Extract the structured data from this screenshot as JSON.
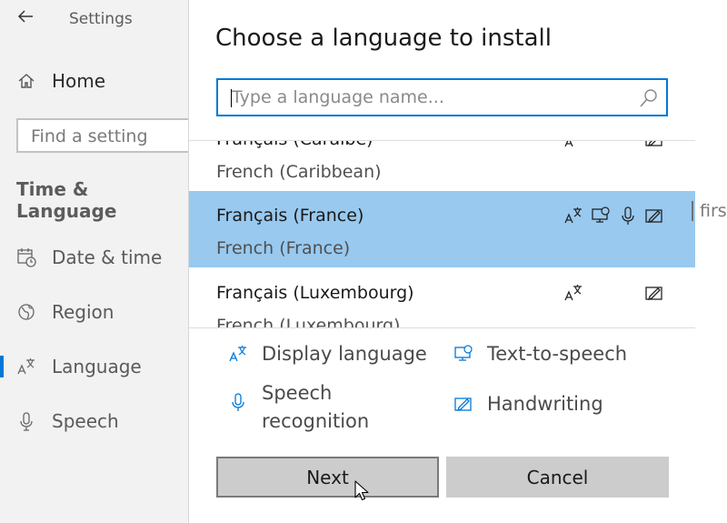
{
  "settings": {
    "title": "Settings",
    "home_label": "Home",
    "find_placeholder": "Find a setting",
    "section_header": "Time & Language",
    "nav": [
      {
        "label": "Date & time",
        "icon": "calendar-clock-icon"
      },
      {
        "label": "Region",
        "icon": "globe-icon"
      },
      {
        "label": "Language",
        "icon": "language-icon",
        "active": true
      },
      {
        "label": "Speech",
        "icon": "microphone-icon"
      }
    ]
  },
  "dialog": {
    "title": "Choose a language to install",
    "search_placeholder": "Type a language name...",
    "search_value": "",
    "languages": [
      {
        "native": "Français (Caraïbe)",
        "english": "French (Caribbean)",
        "features": [
          "display-language",
          "handwriting"
        ],
        "selected": false
      },
      {
        "native": "Français (France)",
        "english": "French (France)",
        "features": [
          "display-language",
          "text-to-speech",
          "speech-recognition",
          "handwriting"
        ],
        "selected": true
      },
      {
        "native": "Français (Luxembourg)",
        "english": "French (Luxembourg)",
        "features": [
          "display-language",
          "handwriting"
        ],
        "selected": false
      }
    ],
    "legend": {
      "display_language": "Display language",
      "text_to_speech": "Text-to-speech",
      "speech_recognition": "Speech recognition",
      "handwriting": "Handwriting"
    },
    "next_label": "Next",
    "cancel_label": "Cancel"
  },
  "background": {
    "right_text": "first"
  },
  "colors": {
    "accent": "#0078d7",
    "selected_row": "#99c9ef",
    "button_bg": "#cccccc"
  }
}
